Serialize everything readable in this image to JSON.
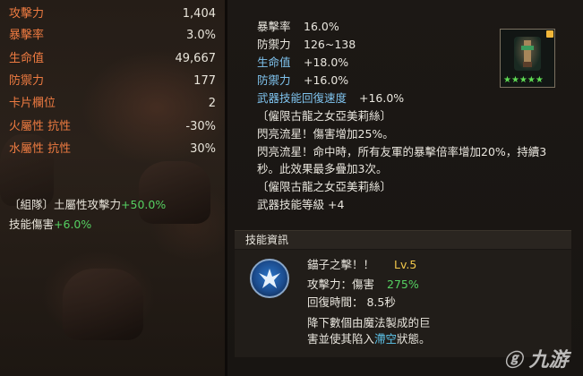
{
  "stats": [
    {
      "label": "攻擊力",
      "value": "1,404"
    },
    {
      "label": "暴擊率",
      "value": "3.0%"
    },
    {
      "label": "生命值",
      "value": "49,667"
    },
    {
      "label": "防禦力",
      "value": "177"
    },
    {
      "label": "卡片欄位",
      "value": "2"
    },
    {
      "label": "火屬性 抗性",
      "value": "-30%"
    },
    {
      "label": "水屬性 抗性",
      "value": "30%"
    }
  ],
  "bonuses": {
    "party_prefix": "〔組隊〕土屬性攻擊力",
    "party_value": "+50.0%",
    "skill_dmg_label": "技能傷害",
    "skill_dmg_value": "+6.0%"
  },
  "tooltip": {
    "crit_label": "暴擊率",
    "crit_value": "16.0%",
    "def_label": "防禦力",
    "def_value": "126~138",
    "hp_label": "生命值",
    "hp_value": "+18.0%",
    "def2_label": "防禦力",
    "def2_value": "+16.0%",
    "recovery_label": "武器技能回復速度",
    "recovery_value": "+16.0%",
    "set_name_1": "〔僱限古龍之女亞美莉絲〕",
    "flash_line": "閃亮流星！傷害增加25%。",
    "flash_desc_1": "閃亮流星！命中時，所有友軍的暴擊倍率增加20%，持續3",
    "flash_desc_2": "秒。此效果最多疊加3次。",
    "set_name_2": "〔僱限古龍之女亞美莉絲〕",
    "skill_level_label": "武器技能等級",
    "skill_level_value": "+4",
    "item_stars": "★★★★★"
  },
  "skill": {
    "header": "技能資訊",
    "name": "錨子之擊！！",
    "level": "Lv.5",
    "attack_label": "攻擊力：傷害",
    "attack_value": "275%",
    "recovery": "回復時間： 8.5秒",
    "desc_1": "降下數個由魔法製成的巨",
    "desc_2a": "害並使其陷入",
    "desc_2b": "滯空",
    "desc_2c": "狀態。"
  },
  "watermark": "九游",
  "colors": {
    "stat_label": "#ee7b41",
    "green": "#55d061",
    "blue": "#7fc3ee",
    "yellow": "#f2c84b"
  }
}
